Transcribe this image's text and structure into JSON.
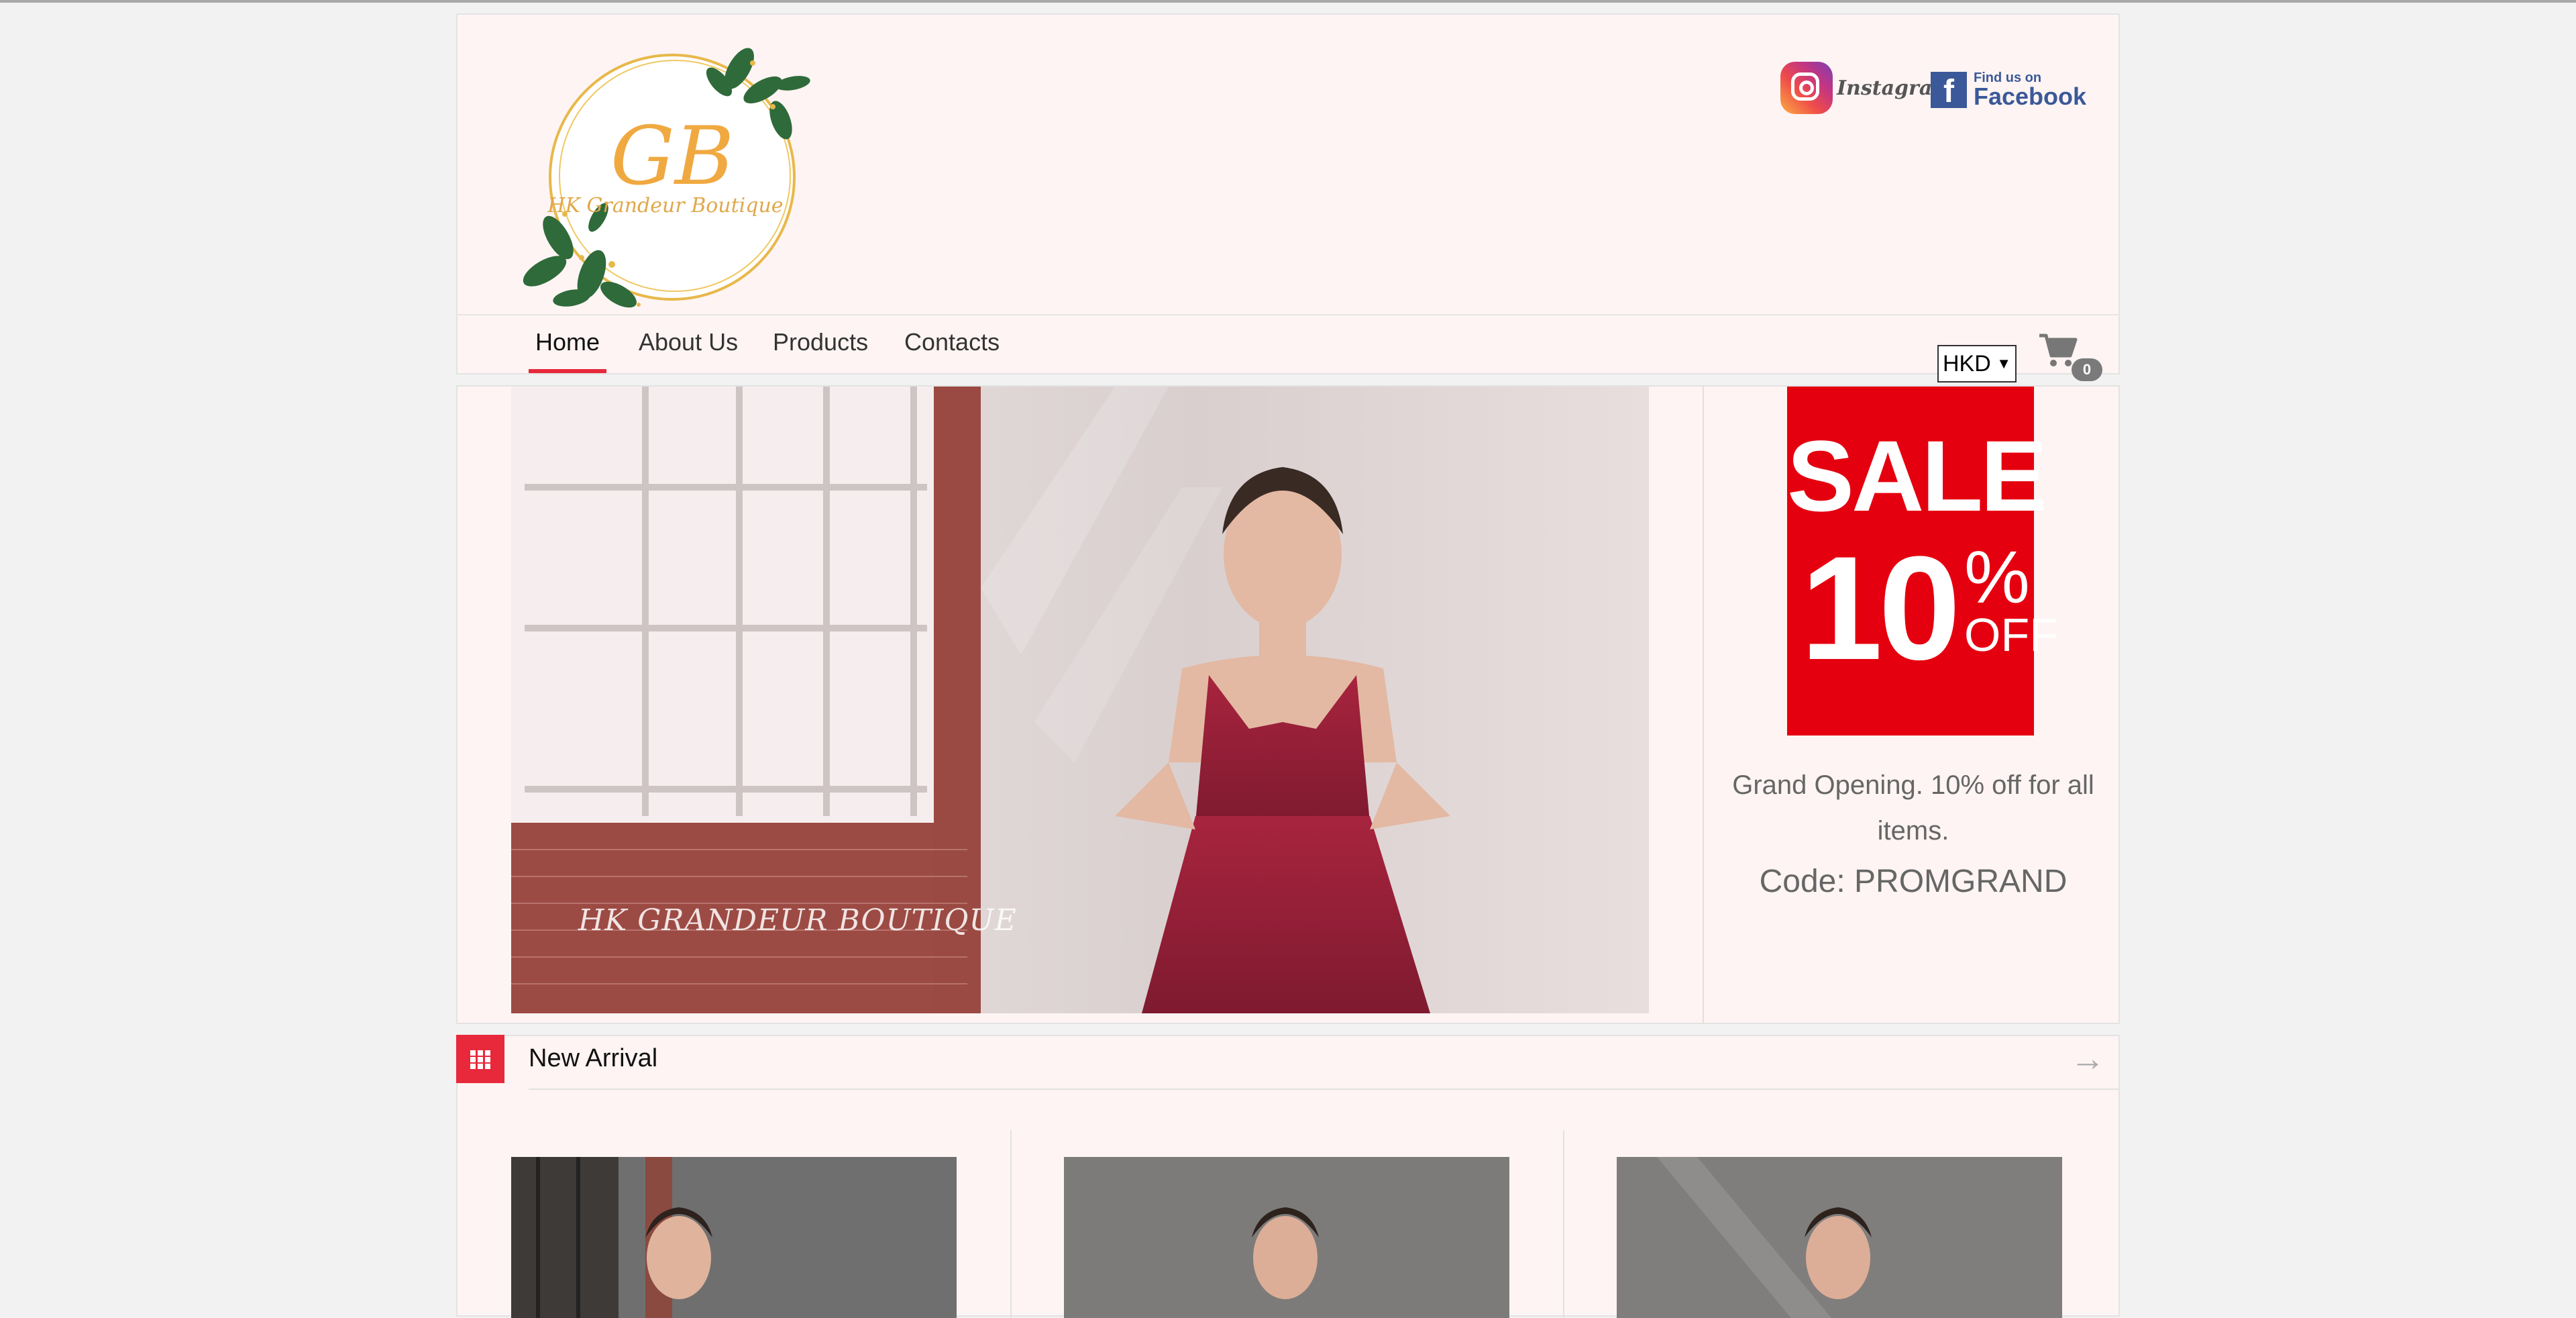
{
  "brand": {
    "logo_monogram": "GB",
    "logo_name": "HK Grandeur Boutique",
    "accent": "#e8283b"
  },
  "social": {
    "instagram_label": "Instagram",
    "facebook_small": "Find us on",
    "facebook_label": "Facebook"
  },
  "nav": {
    "items": [
      {
        "label": "Home",
        "active": true
      },
      {
        "label": "About Us"
      },
      {
        "label": "Products"
      },
      {
        "label": "Contacts"
      }
    ],
    "currency": "HKD",
    "cart_count": "0"
  },
  "hero": {
    "caption": "HK GRANDEUR BOUTIQUE",
    "sale_word": "SALE",
    "sale_percent": "10",
    "sale_pct_sign": "%",
    "sale_off": "OFF",
    "promo_text": "Grand Opening. 10% off for all items.",
    "promo_code": "Code: PROMGRAND"
  },
  "arrivals": {
    "title": "New Arrival"
  }
}
